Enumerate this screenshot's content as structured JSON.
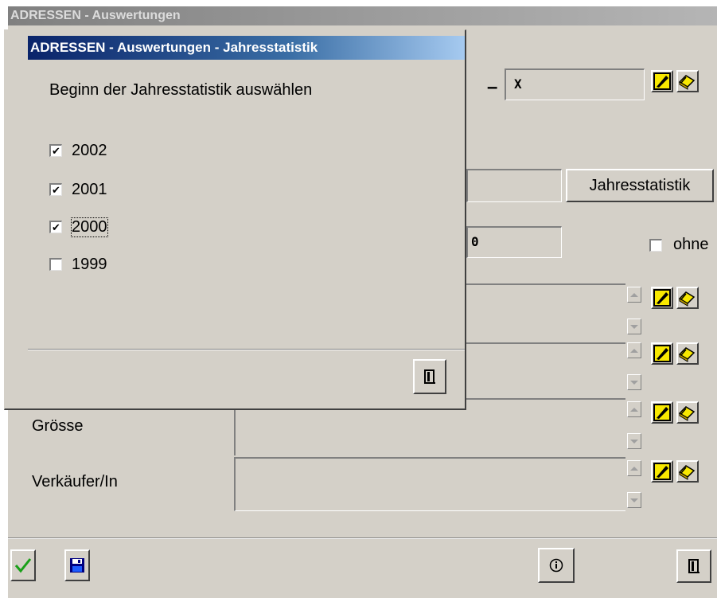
{
  "main_window": {
    "title": "ADRESSEN - Auswertungen",
    "range_dash": "–",
    "range_to_value": "X",
    "jahresstatistik_button": "Jahresstatistik",
    "number_field_value": "0",
    "ohne_label": "ohne",
    "groesse_label": "Grösse",
    "verkaeufer_label": "Verkäufer/In"
  },
  "dialog": {
    "title": "ADRESSEN - Auswertungen - Jahresstatistik",
    "prompt": "Beginn der Jahresstatistik auswählen",
    "years": [
      {
        "label": "2002",
        "checked": true
      },
      {
        "label": "2001",
        "checked": true
      },
      {
        "label": "2000",
        "checked": true
      },
      {
        "label": "1999",
        "checked": false
      }
    ]
  },
  "toolbar": {
    "ok_icon": "checkmark-icon",
    "save_icon": "floppy-disk-icon",
    "info_icon": "info-icon",
    "exit_icon": "door-exit-icon"
  },
  "colors": {
    "window_bg": "#d4d0c8",
    "title_active": "#0a246a",
    "title_inactive": "#808080",
    "check_green": "#19a019",
    "edit_yellow": "#f8e800"
  }
}
